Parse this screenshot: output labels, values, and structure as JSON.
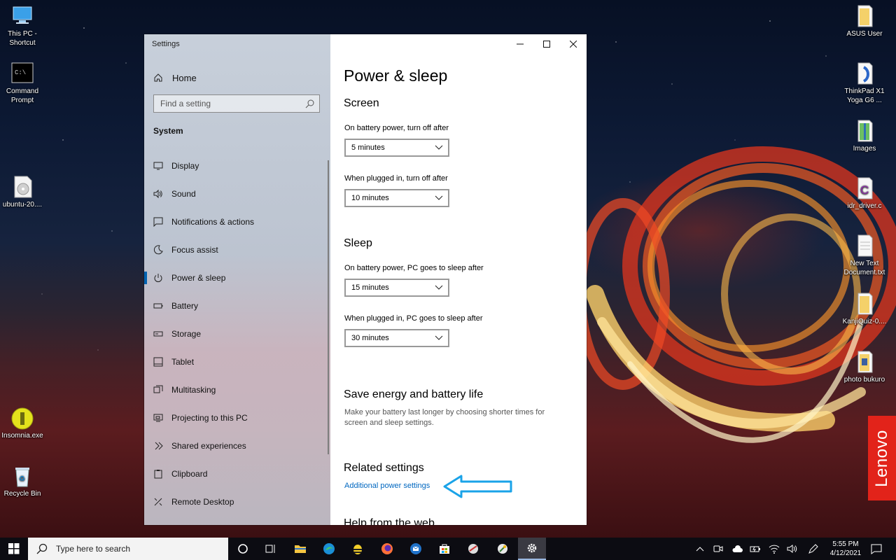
{
  "desktop": {
    "left_icons": [
      {
        "label": "This PC - Shortcut",
        "icon": "this-pc-icon"
      },
      {
        "label": "Command Prompt",
        "icon": "command-prompt-icon"
      },
      {
        "label": "ubuntu-20....",
        "icon": "disc-image-icon"
      },
      {
        "label": "Insomnia.exe",
        "icon": "insomnia-icon"
      },
      {
        "label": "Recycle Bin",
        "icon": "recycle-bin-icon"
      }
    ],
    "right_icons": [
      {
        "label": "ASUS User",
        "icon": "folder-icon"
      },
      {
        "label": "ThinkPad X1 Yoga G6 ...",
        "icon": "folder-icon"
      },
      {
        "label": "Images",
        "icon": "zip-folder-icon"
      },
      {
        "label": "idr_driver.c",
        "icon": "c-file-icon"
      },
      {
        "label": "New Text Document.txt",
        "icon": "text-file-icon"
      },
      {
        "label": "KanjiQuiz-0....",
        "icon": "folder-icon"
      },
      {
        "label": "photo bukuro",
        "icon": "folder-icon"
      }
    ],
    "brand_badge": "Lenovo"
  },
  "settings": {
    "window_title": "Settings",
    "nav": {
      "home_label": "Home",
      "search_placeholder": "Find a setting",
      "section": "System",
      "items": [
        {
          "label": "Display",
          "icon": "display-icon"
        },
        {
          "label": "Sound",
          "icon": "sound-icon"
        },
        {
          "label": "Notifications & actions",
          "icon": "notifications-icon"
        },
        {
          "label": "Focus assist",
          "icon": "focus-assist-icon"
        },
        {
          "label": "Power & sleep",
          "icon": "power-icon",
          "active": true
        },
        {
          "label": "Battery",
          "icon": "battery-icon"
        },
        {
          "label": "Storage",
          "icon": "storage-icon"
        },
        {
          "label": "Tablet",
          "icon": "tablet-icon"
        },
        {
          "label": "Multitasking",
          "icon": "multitasking-icon"
        },
        {
          "label": "Projecting to this PC",
          "icon": "projecting-icon"
        },
        {
          "label": "Shared experiences",
          "icon": "shared-experiences-icon"
        },
        {
          "label": "Clipboard",
          "icon": "clipboard-icon"
        },
        {
          "label": "Remote Desktop",
          "icon": "remote-desktop-icon"
        }
      ]
    },
    "content": {
      "page_title": "Power & sleep",
      "screen": {
        "heading": "Screen",
        "battery_label": "On battery power, turn off after",
        "battery_value": "5 minutes",
        "plugged_label": "When plugged in, turn off after",
        "plugged_value": "10 minutes"
      },
      "sleep": {
        "heading": "Sleep",
        "battery_label": "On battery power, PC goes to sleep after",
        "battery_value": "15 minutes",
        "plugged_label": "When plugged in, PC goes to sleep after",
        "plugged_value": "30 minutes"
      },
      "save_energy": {
        "heading": "Save energy and battery life",
        "description": "Make your battery last longer by choosing shorter times for screen and sleep settings."
      },
      "related": {
        "heading": "Related settings",
        "link": "Additional power settings"
      },
      "cut_off_heading": "Help from the web"
    }
  },
  "taskbar": {
    "search_placeholder": "Type here to search",
    "time": "5:55 PM",
    "date": "4/12/2021",
    "colors": {
      "annotation_arrow": "#1aa3e8",
      "accent": "#0063b1"
    }
  }
}
